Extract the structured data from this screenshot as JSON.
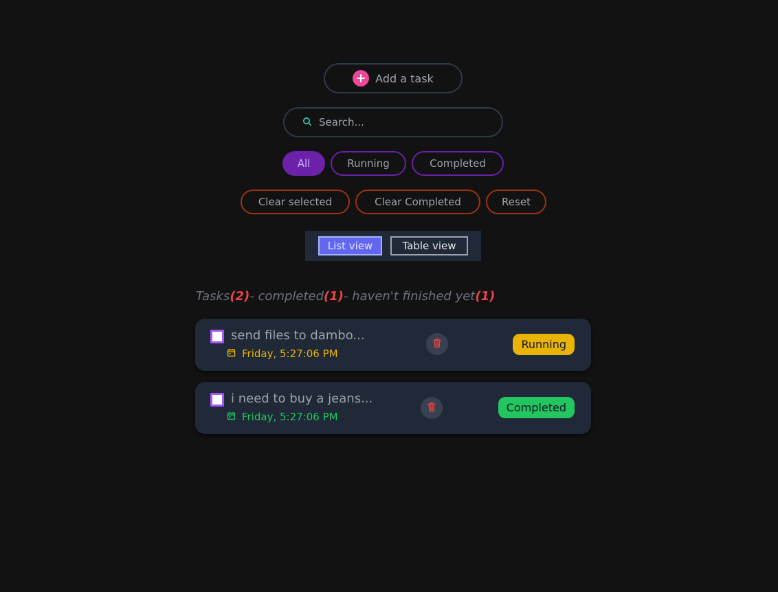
{
  "add_task": {
    "label": "Add a task"
  },
  "search": {
    "placeholder": "Search..."
  },
  "filters": {
    "all": "All",
    "running": "Running",
    "completed": "Completed"
  },
  "actions": {
    "clear_selected": "Clear selected",
    "clear_completed": "Clear Completed",
    "reset": "Reset"
  },
  "view": {
    "list": "List view",
    "table": "Table view"
  },
  "summary": {
    "tasks_label": "Tasks",
    "tasks_count": "(2)",
    "completed_label": "- completed",
    "completed_count": "(1)",
    "unfinished_label": "- haven't finished yet",
    "unfinished_count": "(1)"
  },
  "tasks": [
    {
      "title": "send files to dambo...",
      "date": "Friday, 5:27:06 PM",
      "status": "Running",
      "status_color": "#eab308",
      "date_color": "#eab308"
    },
    {
      "title": "i need to buy a jeans...",
      "date": "Friday, 5:27:06 PM",
      "status": "Completed",
      "status_color": "#22c55e",
      "date_color": "#22c55e"
    }
  ],
  "colors": {
    "background": "#121212",
    "accent_pink": "#ec4899",
    "filter_purple": "#6b21a8",
    "danger_orange": "#9a3412",
    "view_active": "#6366f1",
    "card": "#1f2937",
    "count_red": "#ef4444"
  },
  "icons": {
    "add": "plus-icon",
    "search": "search-icon",
    "date": "calendar-icon",
    "delete": "trash-icon"
  }
}
